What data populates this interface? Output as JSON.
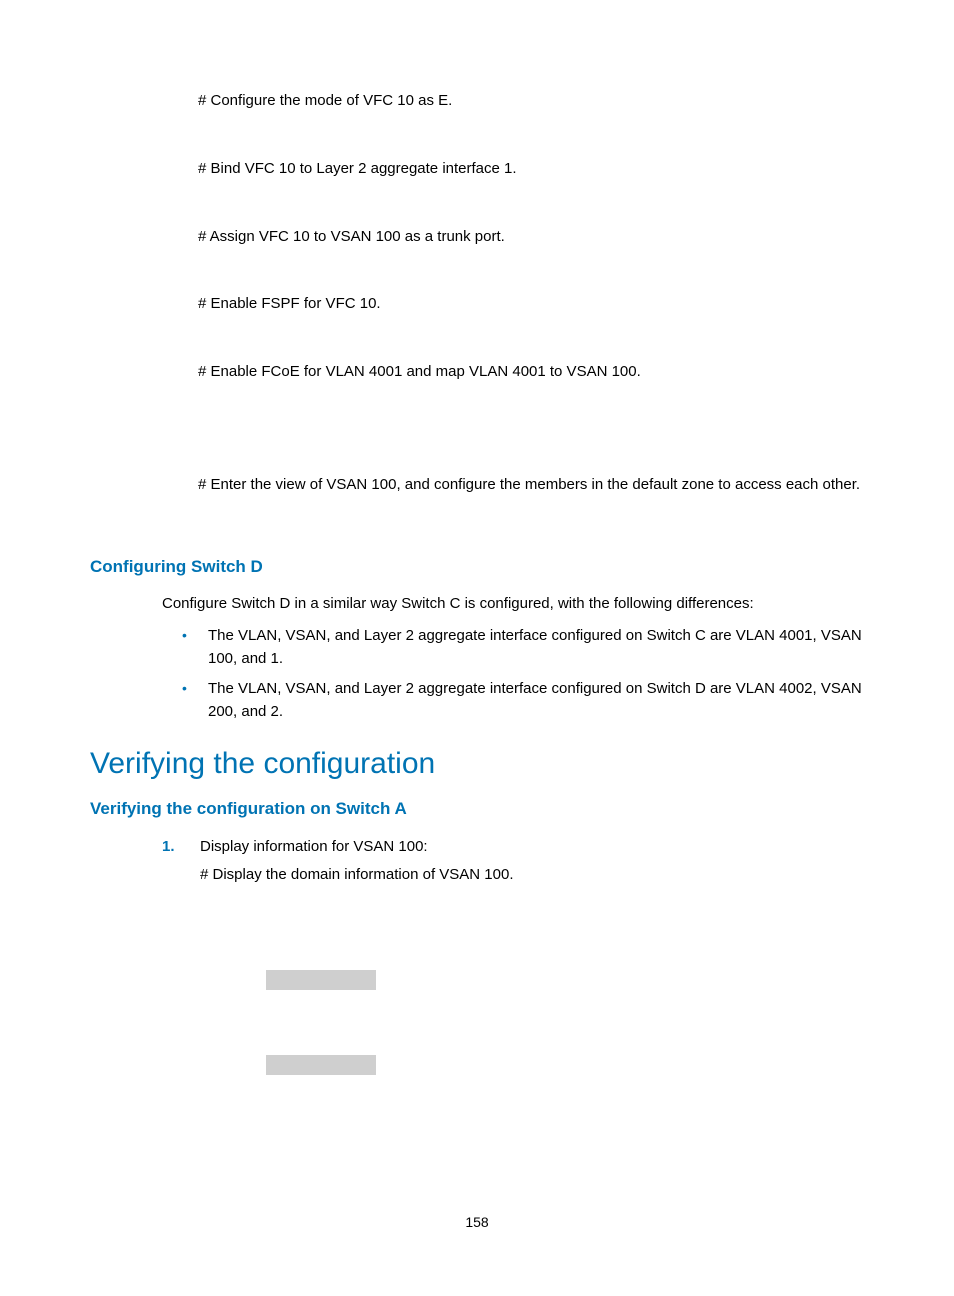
{
  "steps": {
    "s1": "# Configure the mode of VFC 10 as E.",
    "s2": "# Bind VFC 10 to Layer 2 aggregate interface 1.",
    "s3": "# Assign VFC 10 to VSAN 100 as a trunk port.",
    "s4": "# Enable FSPF for VFC 10.",
    "s5": "# Enable FCoE for VLAN 4001 and map VLAN 4001 to VSAN 100.",
    "s6": "# Enter the view of VSAN 100, and configure the members in the default zone to access each other."
  },
  "section_switch_d": {
    "title": "Configuring Switch D",
    "intro": "Configure Switch D in a similar way Switch C is configured, with the following differences:",
    "bullets": [
      "The VLAN, VSAN, and Layer 2 aggregate interface configured on Switch C are VLAN 4001, VSAN 100, and 1.",
      "The VLAN, VSAN, and Layer 2 aggregate interface configured on Switch D are VLAN 4002, VSAN 200, and 2."
    ]
  },
  "verify": {
    "heading": "Verifying the configuration",
    "sub_heading": "Verifying the configuration on Switch A",
    "item_marker": "1.",
    "item_line1": "Display information for VSAN 100:",
    "item_line2": "# Display the domain information of VSAN 100."
  },
  "page_number": "158"
}
